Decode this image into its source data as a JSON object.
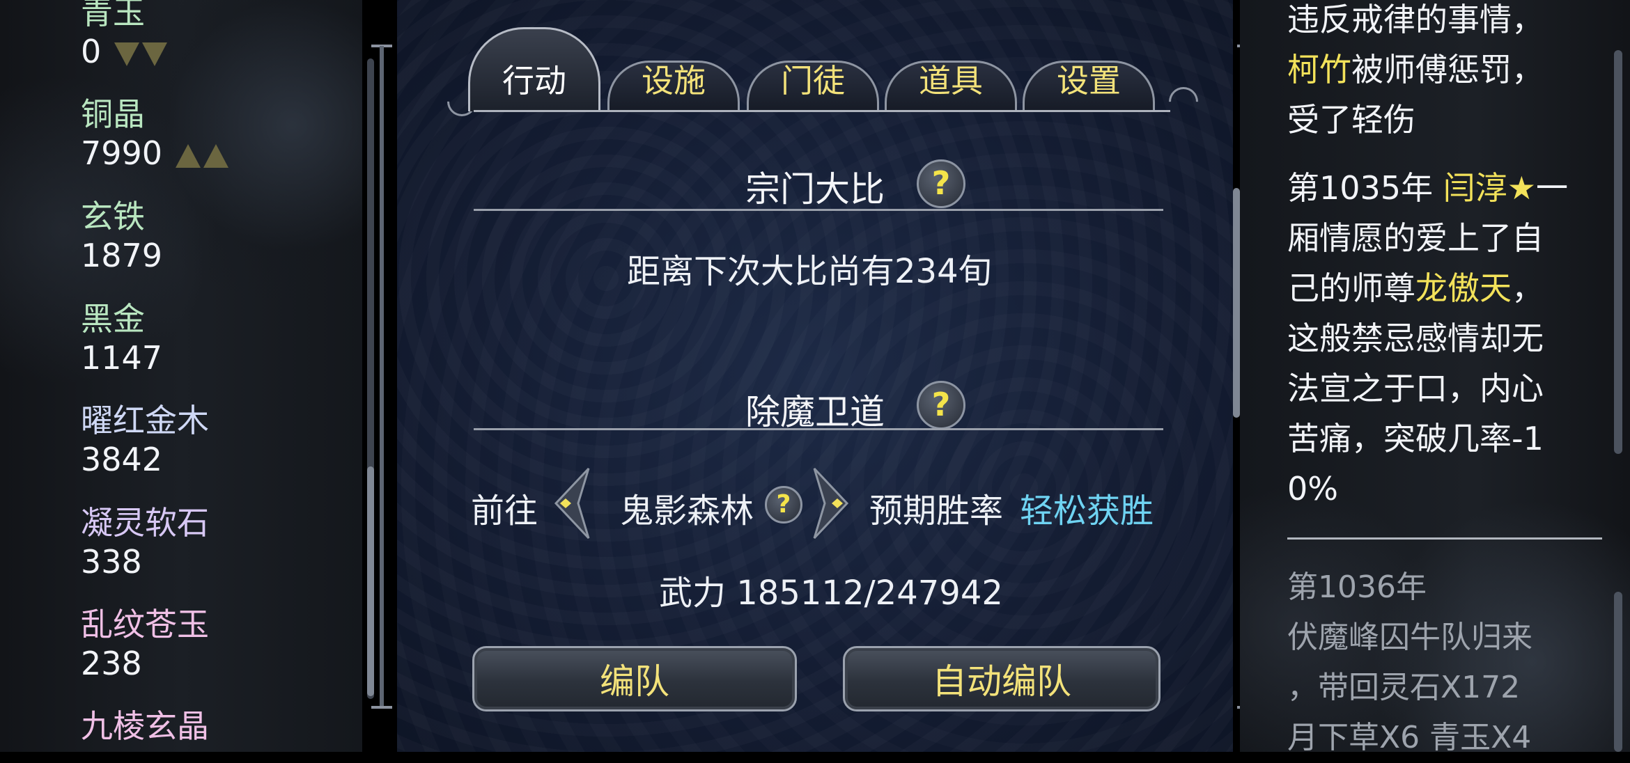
{
  "resources": [
    {
      "name": "青玉",
      "value": "0",
      "trend": "down",
      "color": "#b9e6c0"
    },
    {
      "name": "铜晶",
      "value": "7990",
      "trend": "up",
      "color": "#b9e6c0"
    },
    {
      "name": "玄铁",
      "value": "1879",
      "trend": "",
      "color": "#b9e6c0"
    },
    {
      "name": "黑金",
      "value": "1147",
      "trend": "",
      "color": "#b9e6c0"
    },
    {
      "name": "曜红金木",
      "value": "3842",
      "trend": "",
      "color": "#cfd8f5"
    },
    {
      "name": "凝灵软石",
      "value": "338",
      "trend": "",
      "color": "#d8c8f5"
    },
    {
      "name": "乱纹苍玉",
      "value": "238",
      "trend": "",
      "color": "#f0c0e6"
    },
    {
      "name": "九棱玄晶",
      "value": "",
      "trend": "",
      "color": "#f0c0e6"
    }
  ],
  "tabs": [
    "行动",
    "设施",
    "门徒",
    "道具",
    "设置"
  ],
  "active_tab": "行动",
  "sect_contest": {
    "title": "宗门大比",
    "help": "?",
    "countdown": "距离下次大比尚有234旬"
  },
  "demon_slaying": {
    "title": "除魔卫道",
    "help": "?",
    "goto_label": "前往",
    "location": "鬼影森林",
    "win_rate_label": "预期胜率",
    "win_rate_value": "轻松获胜",
    "power": "武力 185112/247942",
    "btn_team": "编队",
    "btn_auto_team": "自动编队"
  },
  "log": {
    "entry1": {
      "line1": "违反戒律的事情，",
      "name": "柯竹",
      "line2": "被师傅惩罚，",
      "line3": "受了轻伤"
    },
    "entry2": {
      "prefix": "第1035年 ",
      "name": "闫淳★",
      "text1": "一",
      "line2": "厢情愿的爱上了自",
      "line3a": "己的师尊",
      "name2": "龙傲天",
      "line3b": "，",
      "line4": "这般禁忌感情却无",
      "line5": "法宣之于口，内心",
      "line6": "苦痛，突破几率-1",
      "line7": "0%"
    },
    "entry3": {
      "line1": "第1036年",
      "line2": "伏魔峰囚牛队归来",
      "line3": "，带回灵石X172",
      "line4": "月下草X6 青玉X4"
    }
  },
  "colors": {
    "highlight": "#f3e25a",
    "win_rate": "#6fd3f2",
    "tab_text": "#f3e27a"
  }
}
